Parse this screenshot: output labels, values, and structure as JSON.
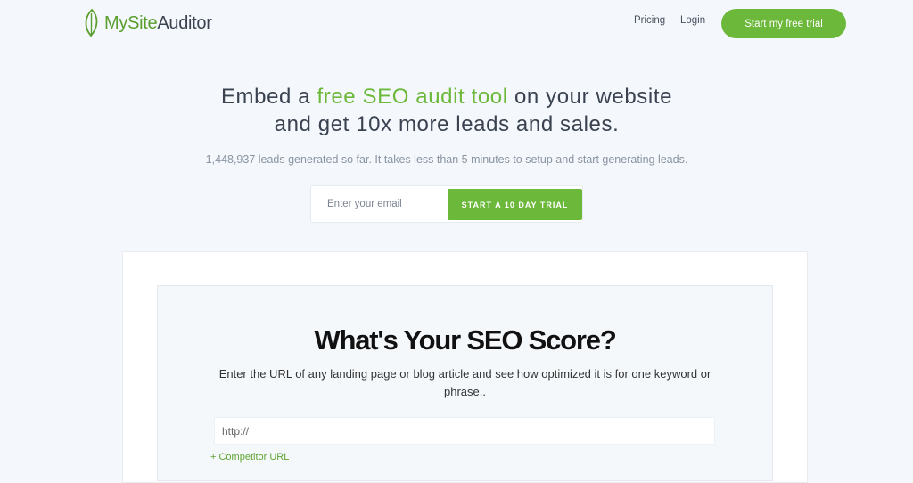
{
  "header": {
    "logo": {
      "part1": "My",
      "part2": "Site",
      "part3": "Auditor",
      "icon": "leaf-icon"
    },
    "nav": {
      "pricing": "Pricing",
      "login": "Login"
    },
    "cta": "Start my free trial"
  },
  "hero": {
    "title_line1_before": "Embed a ",
    "title_highlight": "free SEO audit tool",
    "title_line1_after": " on your website",
    "title_line2": "and get 10x more leads and sales.",
    "subtitle": "1,448,937 leads generated so far. It takes less than 5 minutes to setup and start generating leads.",
    "email_placeholder": "Enter your email",
    "button": "START A 10 DAY TRIAL"
  },
  "widget": {
    "title": "What's Your SEO Score?",
    "description": "Enter the URL of any landing page or blog article and see how optimized it is for one keyword or phrase..",
    "url_placeholder": "http://",
    "competitor_link": "+ Competitor URL"
  },
  "colors": {
    "accent": "#6cb83a",
    "text": "#3a4250",
    "background": "#f4f8fc"
  }
}
